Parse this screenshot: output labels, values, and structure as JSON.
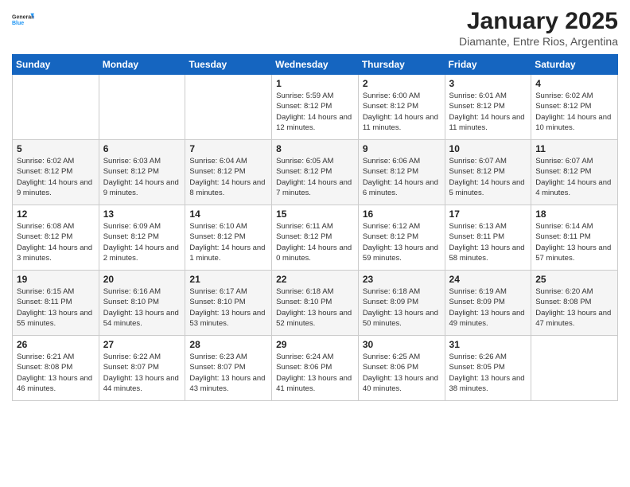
{
  "logo": {
    "line1": "General",
    "line2": "Blue"
  },
  "title": "January 2025",
  "subtitle": "Diamante, Entre Rios, Argentina",
  "weekdays": [
    "Sunday",
    "Monday",
    "Tuesday",
    "Wednesday",
    "Thursday",
    "Friday",
    "Saturday"
  ],
  "weeks": [
    [
      {
        "day": "",
        "info": ""
      },
      {
        "day": "",
        "info": ""
      },
      {
        "day": "",
        "info": ""
      },
      {
        "day": "1",
        "info": "Sunrise: 5:59 AM\nSunset: 8:12 PM\nDaylight: 14 hours and 12 minutes."
      },
      {
        "day": "2",
        "info": "Sunrise: 6:00 AM\nSunset: 8:12 PM\nDaylight: 14 hours and 11 minutes."
      },
      {
        "day": "3",
        "info": "Sunrise: 6:01 AM\nSunset: 8:12 PM\nDaylight: 14 hours and 11 minutes."
      },
      {
        "day": "4",
        "info": "Sunrise: 6:02 AM\nSunset: 8:12 PM\nDaylight: 14 hours and 10 minutes."
      }
    ],
    [
      {
        "day": "5",
        "info": "Sunrise: 6:02 AM\nSunset: 8:12 PM\nDaylight: 14 hours and 9 minutes."
      },
      {
        "day": "6",
        "info": "Sunrise: 6:03 AM\nSunset: 8:12 PM\nDaylight: 14 hours and 9 minutes."
      },
      {
        "day": "7",
        "info": "Sunrise: 6:04 AM\nSunset: 8:12 PM\nDaylight: 14 hours and 8 minutes."
      },
      {
        "day": "8",
        "info": "Sunrise: 6:05 AM\nSunset: 8:12 PM\nDaylight: 14 hours and 7 minutes."
      },
      {
        "day": "9",
        "info": "Sunrise: 6:06 AM\nSunset: 8:12 PM\nDaylight: 14 hours and 6 minutes."
      },
      {
        "day": "10",
        "info": "Sunrise: 6:07 AM\nSunset: 8:12 PM\nDaylight: 14 hours and 5 minutes."
      },
      {
        "day": "11",
        "info": "Sunrise: 6:07 AM\nSunset: 8:12 PM\nDaylight: 14 hours and 4 minutes."
      }
    ],
    [
      {
        "day": "12",
        "info": "Sunrise: 6:08 AM\nSunset: 8:12 PM\nDaylight: 14 hours and 3 minutes."
      },
      {
        "day": "13",
        "info": "Sunrise: 6:09 AM\nSunset: 8:12 PM\nDaylight: 14 hours and 2 minutes."
      },
      {
        "day": "14",
        "info": "Sunrise: 6:10 AM\nSunset: 8:12 PM\nDaylight: 14 hours and 1 minute."
      },
      {
        "day": "15",
        "info": "Sunrise: 6:11 AM\nSunset: 8:12 PM\nDaylight: 14 hours and 0 minutes."
      },
      {
        "day": "16",
        "info": "Sunrise: 6:12 AM\nSunset: 8:12 PM\nDaylight: 13 hours and 59 minutes."
      },
      {
        "day": "17",
        "info": "Sunrise: 6:13 AM\nSunset: 8:11 PM\nDaylight: 13 hours and 58 minutes."
      },
      {
        "day": "18",
        "info": "Sunrise: 6:14 AM\nSunset: 8:11 PM\nDaylight: 13 hours and 57 minutes."
      }
    ],
    [
      {
        "day": "19",
        "info": "Sunrise: 6:15 AM\nSunset: 8:11 PM\nDaylight: 13 hours and 55 minutes."
      },
      {
        "day": "20",
        "info": "Sunrise: 6:16 AM\nSunset: 8:10 PM\nDaylight: 13 hours and 54 minutes."
      },
      {
        "day": "21",
        "info": "Sunrise: 6:17 AM\nSunset: 8:10 PM\nDaylight: 13 hours and 53 minutes."
      },
      {
        "day": "22",
        "info": "Sunrise: 6:18 AM\nSunset: 8:10 PM\nDaylight: 13 hours and 52 minutes."
      },
      {
        "day": "23",
        "info": "Sunrise: 6:18 AM\nSunset: 8:09 PM\nDaylight: 13 hours and 50 minutes."
      },
      {
        "day": "24",
        "info": "Sunrise: 6:19 AM\nSunset: 8:09 PM\nDaylight: 13 hours and 49 minutes."
      },
      {
        "day": "25",
        "info": "Sunrise: 6:20 AM\nSunset: 8:08 PM\nDaylight: 13 hours and 47 minutes."
      }
    ],
    [
      {
        "day": "26",
        "info": "Sunrise: 6:21 AM\nSunset: 8:08 PM\nDaylight: 13 hours and 46 minutes."
      },
      {
        "day": "27",
        "info": "Sunrise: 6:22 AM\nSunset: 8:07 PM\nDaylight: 13 hours and 44 minutes."
      },
      {
        "day": "28",
        "info": "Sunrise: 6:23 AM\nSunset: 8:07 PM\nDaylight: 13 hours and 43 minutes."
      },
      {
        "day": "29",
        "info": "Sunrise: 6:24 AM\nSunset: 8:06 PM\nDaylight: 13 hours and 41 minutes."
      },
      {
        "day": "30",
        "info": "Sunrise: 6:25 AM\nSunset: 8:06 PM\nDaylight: 13 hours and 40 minutes."
      },
      {
        "day": "31",
        "info": "Sunrise: 6:26 AM\nSunset: 8:05 PM\nDaylight: 13 hours and 38 minutes."
      },
      {
        "day": "",
        "info": ""
      }
    ]
  ]
}
